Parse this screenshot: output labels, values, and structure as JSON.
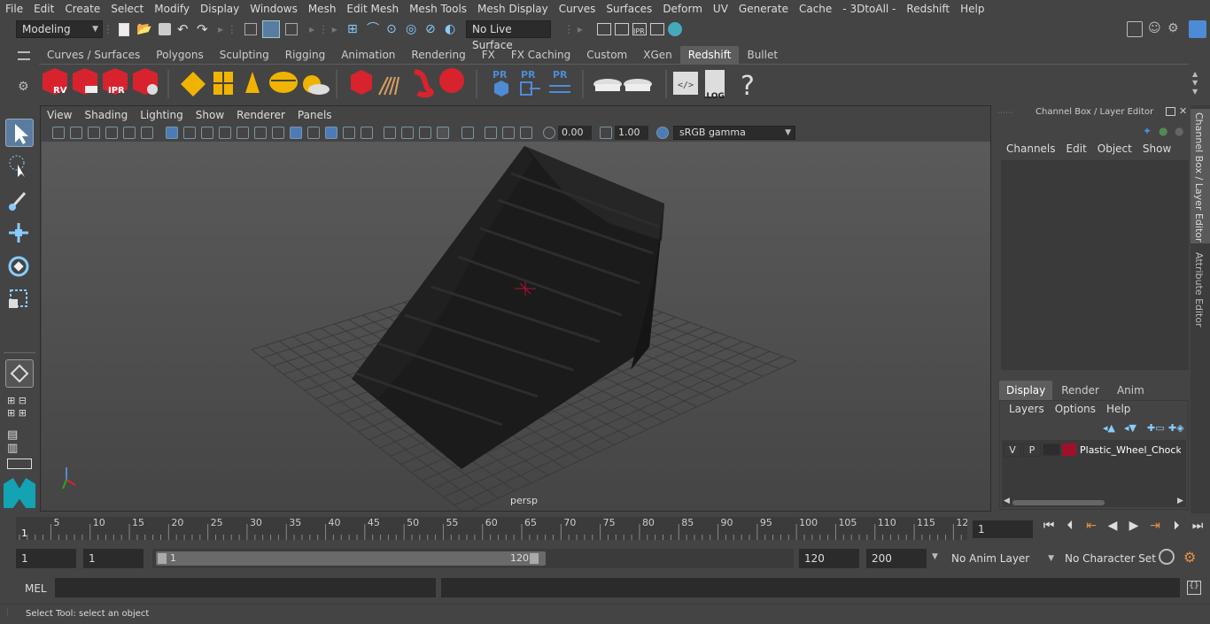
{
  "menubar": {
    "items": [
      "File",
      "Edit",
      "Create",
      "Select",
      "Modify",
      "Display",
      "Windows",
      "Mesh",
      "Edit Mesh",
      "Mesh Tools",
      "Mesh Display",
      "Curves",
      "Surfaces",
      "Deform",
      "UV",
      "Generate",
      "Cache",
      "- 3DtoAll -",
      "Redshift",
      "Help"
    ]
  },
  "statusline": {
    "mode": "Modeling",
    "live_surface": "No Live Surface"
  },
  "shelf": {
    "tabs": [
      "Curves / Surfaces",
      "Polygons",
      "Sculpting",
      "Rigging",
      "Animation",
      "Rendering",
      "FX",
      "FX Caching",
      "Custom",
      "XGen",
      "Redshift",
      "Bullet"
    ],
    "active_tab": "Redshift",
    "icon_labels": {
      "rv": "RV",
      "ipr": "IPR",
      "pr1": "PR",
      "pr2": "PR",
      "pr3": "PR",
      "log": ".LOG",
      "help": "?"
    }
  },
  "viewport": {
    "menu": [
      "View",
      "Shading",
      "Lighting",
      "Show",
      "Renderer",
      "Panels"
    ],
    "exposure": "0.00",
    "gamma": "1.00",
    "color_space": "sRGB gamma",
    "camera_label": "persp"
  },
  "channel_box": {
    "title": "Channel Box / Layer Editor",
    "menu": [
      "Channels",
      "Edit",
      "Object",
      "Show"
    ],
    "layer_tabs": [
      "Display",
      "Render",
      "Anim"
    ],
    "active_layer_tab": "Display",
    "layer_menu": [
      "Layers",
      "Options",
      "Help"
    ],
    "layer": {
      "v": "V",
      "p": "P",
      "name": "Plastic_Wheel_Chock_I",
      "color": "#a0102a"
    }
  },
  "side_tabs": [
    "Channel Box / Layer Editor",
    "Attribute Editor"
  ],
  "timeline": {
    "ticks": [
      "5",
      "10",
      "15",
      "20",
      "25",
      "30",
      "35",
      "40",
      "45",
      "50",
      "55",
      "60",
      "65",
      "70",
      "75",
      "80",
      "85",
      "90",
      "95",
      "100",
      "105",
      "110",
      "115",
      "12"
    ],
    "start_marker": "1",
    "current_frame": "1"
  },
  "range": {
    "start": "1",
    "playback_start": "1",
    "slider_start": "1",
    "slider_end": "120",
    "playback_end": "120",
    "end": "200",
    "anim_layer": "No Anim Layer",
    "character_set": "No Character Set"
  },
  "command": {
    "label": "MEL"
  },
  "help": {
    "text": "Select Tool: select an object"
  },
  "colors": {
    "accent_blue": "#4e8bd6",
    "redshift_red": "#d8232e",
    "gold": "#f0b400"
  }
}
